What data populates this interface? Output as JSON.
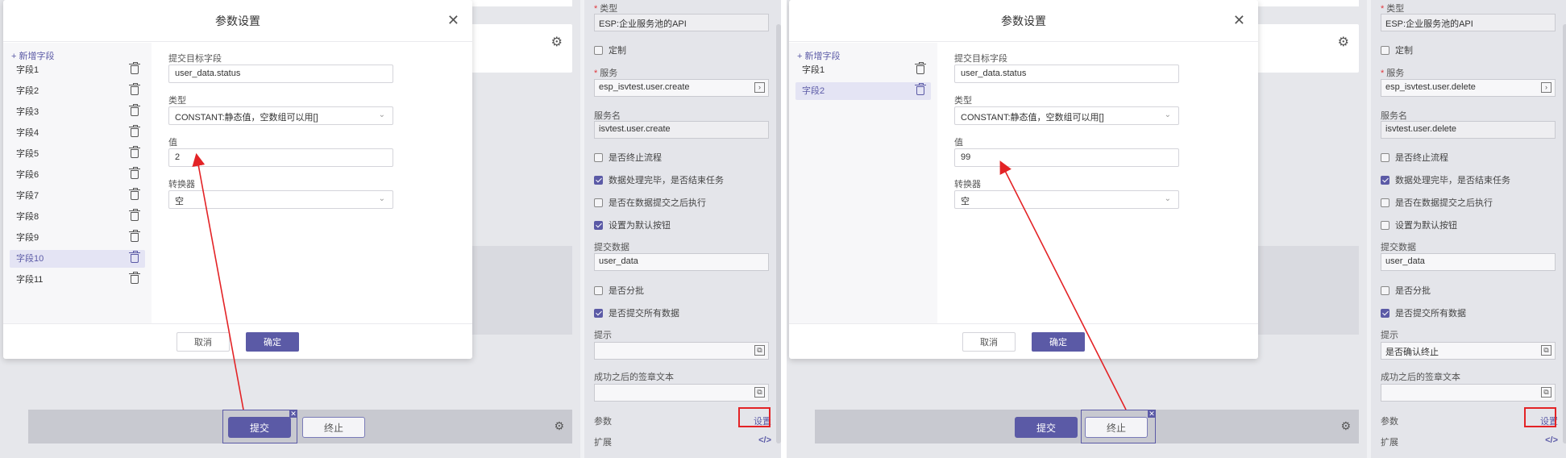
{
  "left": {
    "dialog": {
      "title": "参数设置",
      "add_field": "+ 新增字段",
      "fields": [
        "字段1",
        "字段2",
        "字段3",
        "字段4",
        "字段5",
        "字段6",
        "字段7",
        "字段8",
        "字段9",
        "字段10",
        "字段11"
      ],
      "active_field": "字段10",
      "target_label": "提交目标字段",
      "target_value": "user_data.status",
      "type_label": "类型",
      "type_value": "CONSTANT:静态值，空数组可以用[]",
      "value_label": "值",
      "value_value": "2",
      "converter_label": "转换器",
      "converter_value": "空",
      "cancel": "取消",
      "ok": "确定"
    },
    "canvas": {
      "submit": "提交",
      "stop": "终止"
    },
    "props": {
      "type_label": "类型",
      "type_value": "ESP:企业服务池的API",
      "custom": "定制",
      "service_label": "服务",
      "service_value": "esp_isvtest.user.create",
      "service_name_label": "服务名",
      "service_name_value": "isvtest.user.create",
      "chk_abort": "是否终止流程",
      "chk_abort_on": false,
      "chk_end_task": "数据处理完毕，是否结束任务",
      "chk_end_task_on": true,
      "chk_after_submit": "是否在数据提交之后执行",
      "chk_after_submit_on": false,
      "chk_default_btn": "设置为默认按钮",
      "chk_default_btn_on": true,
      "submit_data_label": "提交数据",
      "submit_data_value": "user_data",
      "chk_batch": "是否分批",
      "chk_batch_on": false,
      "chk_submit_all": "是否提交所有数据",
      "chk_submit_all_on": true,
      "hint_label": "提示",
      "hint_value": "",
      "success_label": "成功之后的签章文本",
      "params_label": "参数",
      "params_set": "设置",
      "ext_label": "扩展"
    }
  },
  "right": {
    "dialog": {
      "title": "参数设置",
      "add_field": "+ 新增字段",
      "fields": [
        "字段1",
        "字段2"
      ],
      "active_field": "字段2",
      "target_label": "提交目标字段",
      "target_value": "user_data.status",
      "type_label": "类型",
      "type_value": "CONSTANT:静态值，空数组可以用[]",
      "value_label": "值",
      "value_value": "99",
      "converter_label": "转换器",
      "converter_value": "空",
      "cancel": "取消",
      "ok": "确定"
    },
    "canvas": {
      "submit": "提交",
      "stop": "终止"
    },
    "props": {
      "type_label": "类型",
      "type_value": "ESP:企业服务池的API",
      "custom": "定制",
      "service_label": "服务",
      "service_value": "esp_isvtest.user.delete",
      "service_name_label": "服务名",
      "service_name_value": "isvtest.user.delete",
      "chk_abort": "是否终止流程",
      "chk_abort_on": false,
      "chk_end_task": "数据处理完毕，是否结束任务",
      "chk_end_task_on": true,
      "chk_after_submit": "是否在数据提交之后执行",
      "chk_after_submit_on": false,
      "chk_default_btn": "设置为默认按钮",
      "chk_default_btn_on": false,
      "submit_data_label": "提交数据",
      "submit_data_value": "user_data",
      "chk_batch": "是否分批",
      "chk_batch_on": false,
      "chk_submit_all": "是否提交所有数据",
      "chk_submit_all_on": true,
      "hint_label": "提示",
      "hint_value": "是否确认终止",
      "success_label": "成功之后的签章文本",
      "params_label": "参数",
      "params_set": "设置",
      "ext_label": "扩展"
    }
  },
  "colors": {
    "accent": "#5b5aa6",
    "annotation_red": "#e32326"
  }
}
